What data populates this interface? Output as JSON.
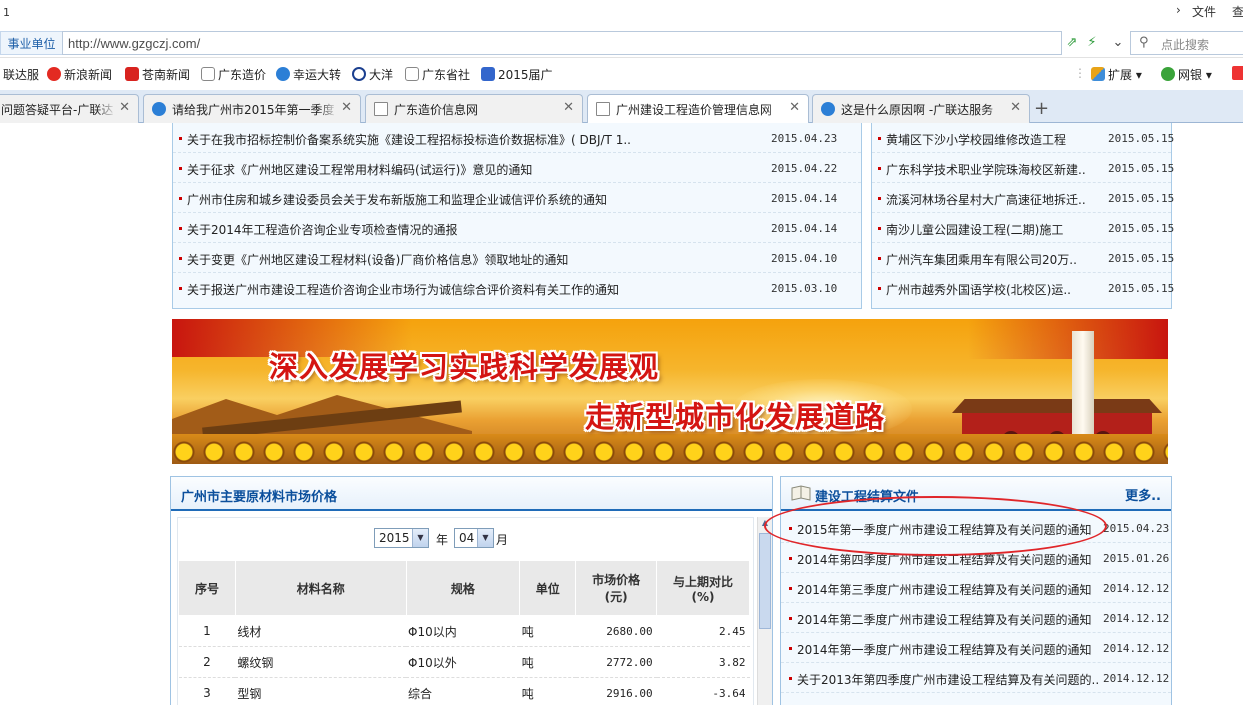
{
  "titlebar": {
    "number": "1",
    "menu_file": "文件",
    "menu_view": "查"
  },
  "address": {
    "site_label": "事业单位",
    "url": "http://www.gzgczj.com/",
    "search_placeholder": "点此搜索"
  },
  "favorites": {
    "items": [
      "联达服",
      "新浪新闻",
      "苍南新闻",
      "广东造价",
      "幸运大转",
      "大洋",
      "广东省社",
      "2015届广"
    ],
    "right": [
      "扩展",
      "网银"
    ]
  },
  "tabs": [
    {
      "label": "问题答疑平台-广联达"
    },
    {
      "label": "请给我广州市2015年第一季度"
    },
    {
      "label": "广东造价信息网"
    },
    {
      "label": "广州建设工程造价管理信息网"
    },
    {
      "label": "这是什么原因啊 -广联达服务"
    }
  ],
  "left_news": [
    {
      "title": "关于在我市招标控制价备案系统实施《建设工程招标投标造价数据标准》( DBJ/T 1..",
      "date": "2015.04.23"
    },
    {
      "title": "关于征求《广州地区建设工程常用材料编码(试运行)》意见的通知",
      "date": "2015.04.22"
    },
    {
      "title": "广州市住房和城乡建设委员会关于发布新版施工和监理企业诚信评价系统的通知",
      "date": "2015.04.14"
    },
    {
      "title": "关于2014年工程造价咨询企业专项检查情况的通报",
      "date": "2015.04.14"
    },
    {
      "title": "关于变更《广州地区建设工程材料(设备)厂商价格信息》领取地址的通知",
      "date": "2015.04.10"
    },
    {
      "title": "关于报送广州市建设工程造价咨询企业市场行为诚信综合评价资料有关工作的通知",
      "date": "2015.03.10"
    }
  ],
  "right_news": [
    {
      "title": "黄埔区下沙小学校园维修改造工程",
      "date": "2015.05.15"
    },
    {
      "title": "广东科学技术职业学院珠海校区新建..",
      "date": "2015.05.15"
    },
    {
      "title": "流溪河林场谷星村大广高速征地拆迁..",
      "date": "2015.05.15"
    },
    {
      "title": "南沙儿童公园建设工程(二期)施工",
      "date": "2015.05.15"
    },
    {
      "title": "广州汽车集团乘用车有限公司20万..",
      "date": "2015.05.15"
    },
    {
      "title": "广州市越秀外国语学校(北校区)运..",
      "date": "2015.05.15"
    }
  ],
  "banner": {
    "line1": "深入发展学习实践科学发展观",
    "line2": "走新型城市化发展道路"
  },
  "materials": {
    "title": "广州市主要原材料市场价格",
    "year": "2015",
    "year_label": "年",
    "month": "04",
    "month_label": "月",
    "headers": [
      "序号",
      "材料名称",
      "规格",
      "单位",
      "市场价格\n(元)",
      "与上期对比\n(%)"
    ],
    "header_price_1": "市场价格",
    "header_price_2": "(元)",
    "header_cmp_1": "与上期对比",
    "header_cmp_2": "(%)",
    "rows": [
      {
        "no": "1",
        "name": "线材",
        "spec": "Φ10以内",
        "unit": "吨",
        "price": "2680.00",
        "change": "2.45"
      },
      {
        "no": "2",
        "name": "螺纹钢",
        "spec": "Φ10以外",
        "unit": "吨",
        "price": "2772.00",
        "change": "3.82"
      },
      {
        "no": "3",
        "name": "型钢",
        "spec": "综合",
        "unit": "吨",
        "price": "2916.00",
        "change": "-3.64"
      }
    ]
  },
  "settlement": {
    "title": "建设工程结算文件",
    "more": "更多..",
    "items": [
      {
        "title": "2015年第一季度广州市建设工程结算及有关问题的通知",
        "date": "2015.04.23"
      },
      {
        "title": "2014年第四季度广州市建设工程结算及有关问题的通知",
        "date": "2015.01.26"
      },
      {
        "title": "2014年第三季度广州市建设工程结算及有关问题的通知",
        "date": "2014.12.12"
      },
      {
        "title": "2014年第二季度广州市建设工程结算及有关问题的通知",
        "date": "2014.12.12"
      },
      {
        "title": "2014年第一季度广州市建设工程结算及有关问题的通知",
        "date": "2014.12.12"
      },
      {
        "title": "关于2013年第四季度广州市建设工程结算及有关问题的..",
        "date": "2014.12.12"
      }
    ]
  },
  "colors": {
    "highlight": "#e0262a",
    "accent": "#1f6bb8",
    "slogan": "#d41512"
  }
}
